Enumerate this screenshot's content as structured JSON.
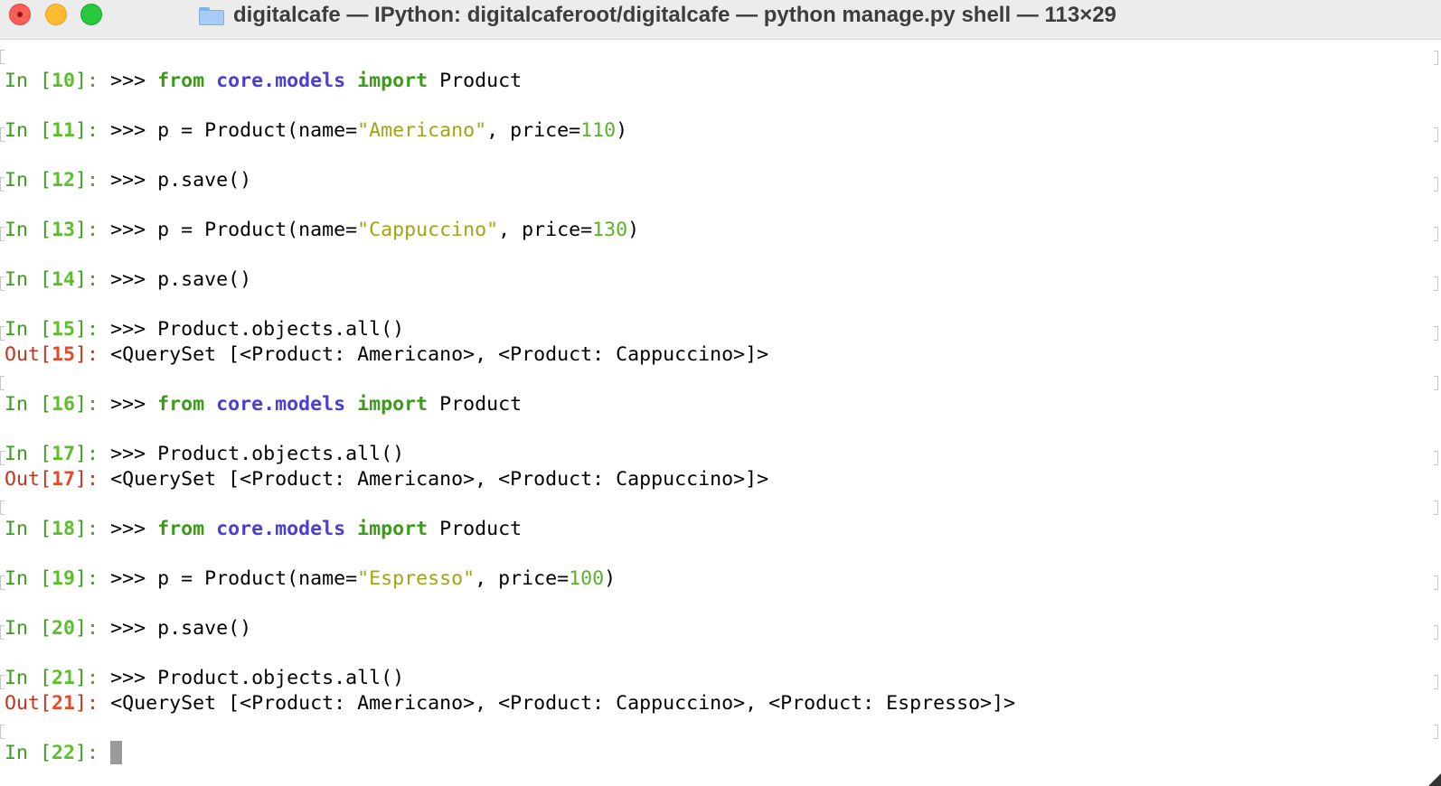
{
  "window": {
    "title": "digitalcafe — IPython: digitalcaferoot/digitalcafe — python manage.py shell — 113×29"
  },
  "lines": [
    {
      "in": "10",
      "prefix": ">>> ",
      "kw1": "from",
      "mod": "core.models",
      "kw2": "import",
      "name": "Product"
    },
    {
      "in": "11",
      "prefix": ">>> p = Product(name=",
      "str": "\"Americano\"",
      "mid": ", price=",
      "num": "110",
      "end": ")"
    },
    {
      "in": "12",
      "code": ">>> p.save()"
    },
    {
      "in": "13",
      "prefix": ">>> p = Product(name=",
      "str": "\"Cappuccino\"",
      "mid": ", price=",
      "num": "130",
      "end": ")"
    },
    {
      "in": "14",
      "code": ">>> p.save()"
    },
    {
      "in": "15",
      "code": ">>> Product.objects.all()"
    },
    {
      "out": "15",
      "code": "<QuerySet [<Product: Americano>, <Product: Cappuccino>]>"
    },
    {
      "in": "16",
      "prefix": ">>> ",
      "kw1": "from",
      "mod": "core.models",
      "kw2": "import",
      "name": "Product"
    },
    {
      "in": "17",
      "code": ">>> Product.objects.all()"
    },
    {
      "out": "17",
      "code": "<QuerySet [<Product: Americano>, <Product: Cappuccino>]>"
    },
    {
      "in": "18",
      "prefix": ">>> ",
      "kw1": "from",
      "mod": "core.models",
      "kw2": "import",
      "name": "Product"
    },
    {
      "in": "19",
      "prefix": ">>> p = Product(name=",
      "str": "\"Espresso\"",
      "mid": ", price=",
      "num": "100",
      "end": ")"
    },
    {
      "in": "20",
      "code": ">>> p.save()"
    },
    {
      "in": "21",
      "code": ">>> Product.objects.all()"
    },
    {
      "out": "21",
      "code": "<QuerySet [<Product: Americano>, <Product: Cappuccino>, <Product: Espresso>]>"
    },
    {
      "in": "22",
      "code": ""
    }
  ],
  "labels": {
    "in_word": "In ",
    "out_word": "Out",
    "open": "[",
    "close": "]: "
  },
  "colors": {
    "prompt_in": "#3b9e1f",
    "prompt_out": "#c0351f",
    "keyword": "#3d9b1a",
    "module": "#4a3fd0",
    "string": "#a5a216",
    "number": "#59b32a"
  }
}
